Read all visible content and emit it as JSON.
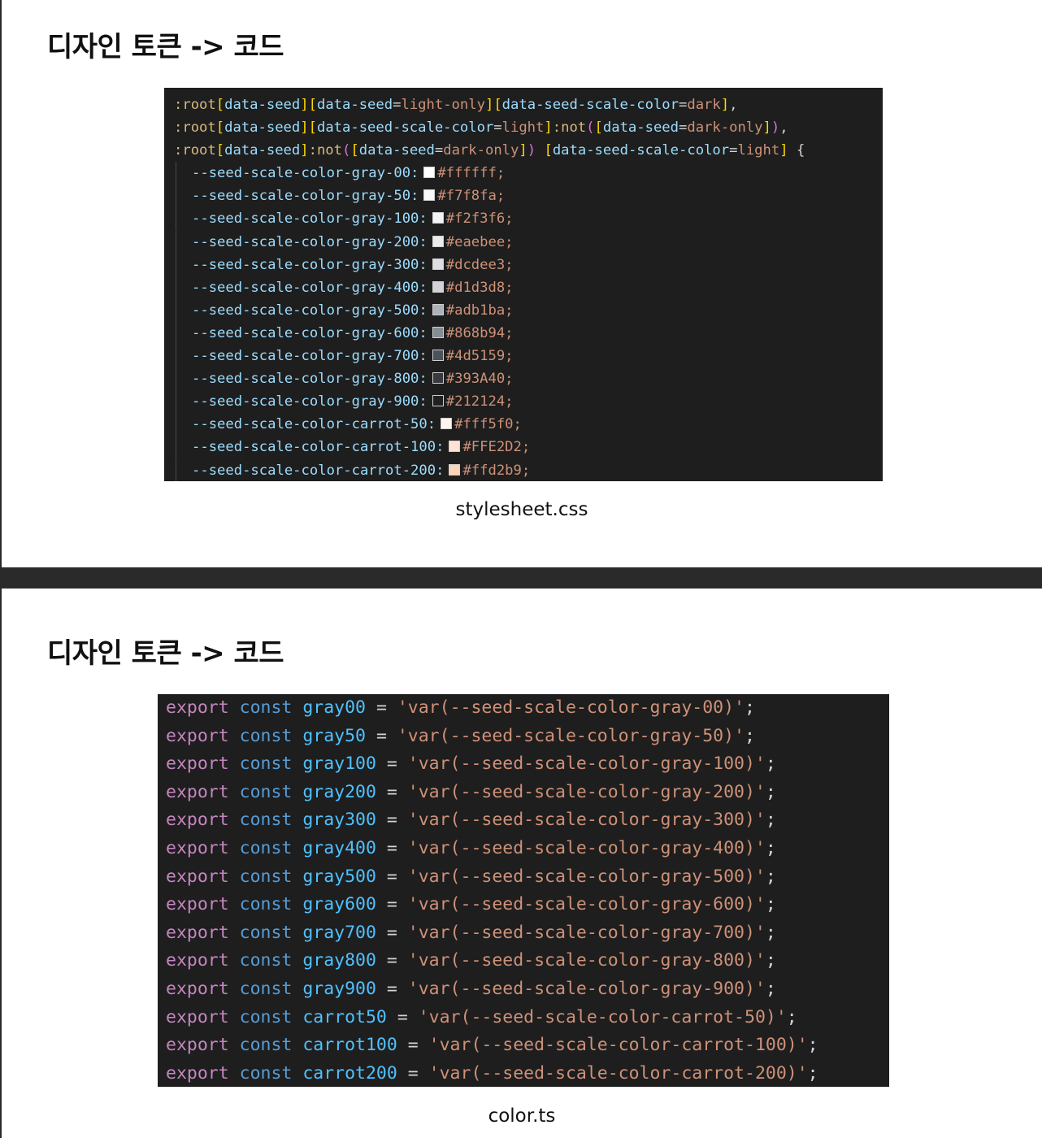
{
  "slides": [
    {
      "title": "디자인 토큰 -> 코드",
      "caption": "stylesheet.css",
      "selectors": [
        ":root[data-seed][data-seed=light-only][data-seed-scale-color=dark],",
        ":root[data-seed][data-seed-scale-color=light]:not([data-seed=dark-only]),",
        ":root[data-seed]:not([data-seed=dark-only]) [data-seed-scale-color=light] {"
      ],
      "declarations": [
        {
          "prop": "--seed-scale-color-gray-00:",
          "value": "#ffffff;",
          "swatch": "#ffffff"
        },
        {
          "prop": "--seed-scale-color-gray-50:",
          "value": "#f7f8fa;",
          "swatch": "#f7f8fa"
        },
        {
          "prop": "--seed-scale-color-gray-100:",
          "value": "#f2f3f6;",
          "swatch": "#f2f3f6"
        },
        {
          "prop": "--seed-scale-color-gray-200:",
          "value": "#eaebee;",
          "swatch": "#eaebee"
        },
        {
          "prop": "--seed-scale-color-gray-300:",
          "value": "#dcdee3;",
          "swatch": "#dcdee3"
        },
        {
          "prop": "--seed-scale-color-gray-400:",
          "value": "#d1d3d8;",
          "swatch": "#d1d3d8"
        },
        {
          "prop": "--seed-scale-color-gray-500:",
          "value": "#adb1ba;",
          "swatch": "#adb1ba"
        },
        {
          "prop": "--seed-scale-color-gray-600:",
          "value": "#868b94;",
          "swatch": "#868b94"
        },
        {
          "prop": "--seed-scale-color-gray-700:",
          "value": "#4d5159;",
          "swatch": "#4d5159"
        },
        {
          "prop": "--seed-scale-color-gray-800:",
          "value": "#393A40;",
          "swatch": "#393A40"
        },
        {
          "prop": "--seed-scale-color-gray-900:",
          "value": "#212124;",
          "swatch": "#212124"
        },
        {
          "prop": "--seed-scale-color-carrot-50:",
          "value": "#fff5f0;",
          "swatch": "#fff5f0"
        },
        {
          "prop": "--seed-scale-color-carrot-100:",
          "value": "#FFE2D2;",
          "swatch": "#FFE2D2"
        },
        {
          "prop": "--seed-scale-color-carrot-200:",
          "value": "#ffd2b9;",
          "swatch": "#ffd2b9"
        }
      ]
    },
    {
      "title": "디자인 토큰 -> 코드",
      "caption": "color.ts",
      "keyword_export": "export",
      "keyword_const": "const",
      "equals": "=",
      "exports": [
        {
          "name": "gray00",
          "value": "'var(--seed-scale-color-gray-00)'",
          "end": ";"
        },
        {
          "name": "gray50",
          "value": "'var(--seed-scale-color-gray-50)'",
          "end": ";"
        },
        {
          "name": "gray100",
          "value": "'var(--seed-scale-color-gray-100)'",
          "end": ";"
        },
        {
          "name": "gray200",
          "value": "'var(--seed-scale-color-gray-200)'",
          "end": ";"
        },
        {
          "name": "gray300",
          "value": "'var(--seed-scale-color-gray-300)'",
          "end": ";"
        },
        {
          "name": "gray400",
          "value": "'var(--seed-scale-color-gray-400)'",
          "end": ";"
        },
        {
          "name": "gray500",
          "value": "'var(--seed-scale-color-gray-500)'",
          "end": ";"
        },
        {
          "name": "gray600",
          "value": "'var(--seed-scale-color-gray-600)'",
          "end": ";"
        },
        {
          "name": "gray700",
          "value": "'var(--seed-scale-color-gray-700)'",
          "end": ";"
        },
        {
          "name": "gray800",
          "value": "'var(--seed-scale-color-gray-800)'",
          "end": ";"
        },
        {
          "name": "gray900",
          "value": "'var(--seed-scale-color-gray-900)'",
          "end": ";"
        },
        {
          "name": "carrot50",
          "value": "'var(--seed-scale-color-carrot-50)'",
          "end": ";"
        },
        {
          "name": "carrot100",
          "value": "'var(--seed-scale-color-carrot-100)'",
          "end": ";"
        },
        {
          "name": "carrot200",
          "value": "'var(--seed-scale-color-carrot-200)'",
          "end": ";"
        }
      ]
    }
  ]
}
